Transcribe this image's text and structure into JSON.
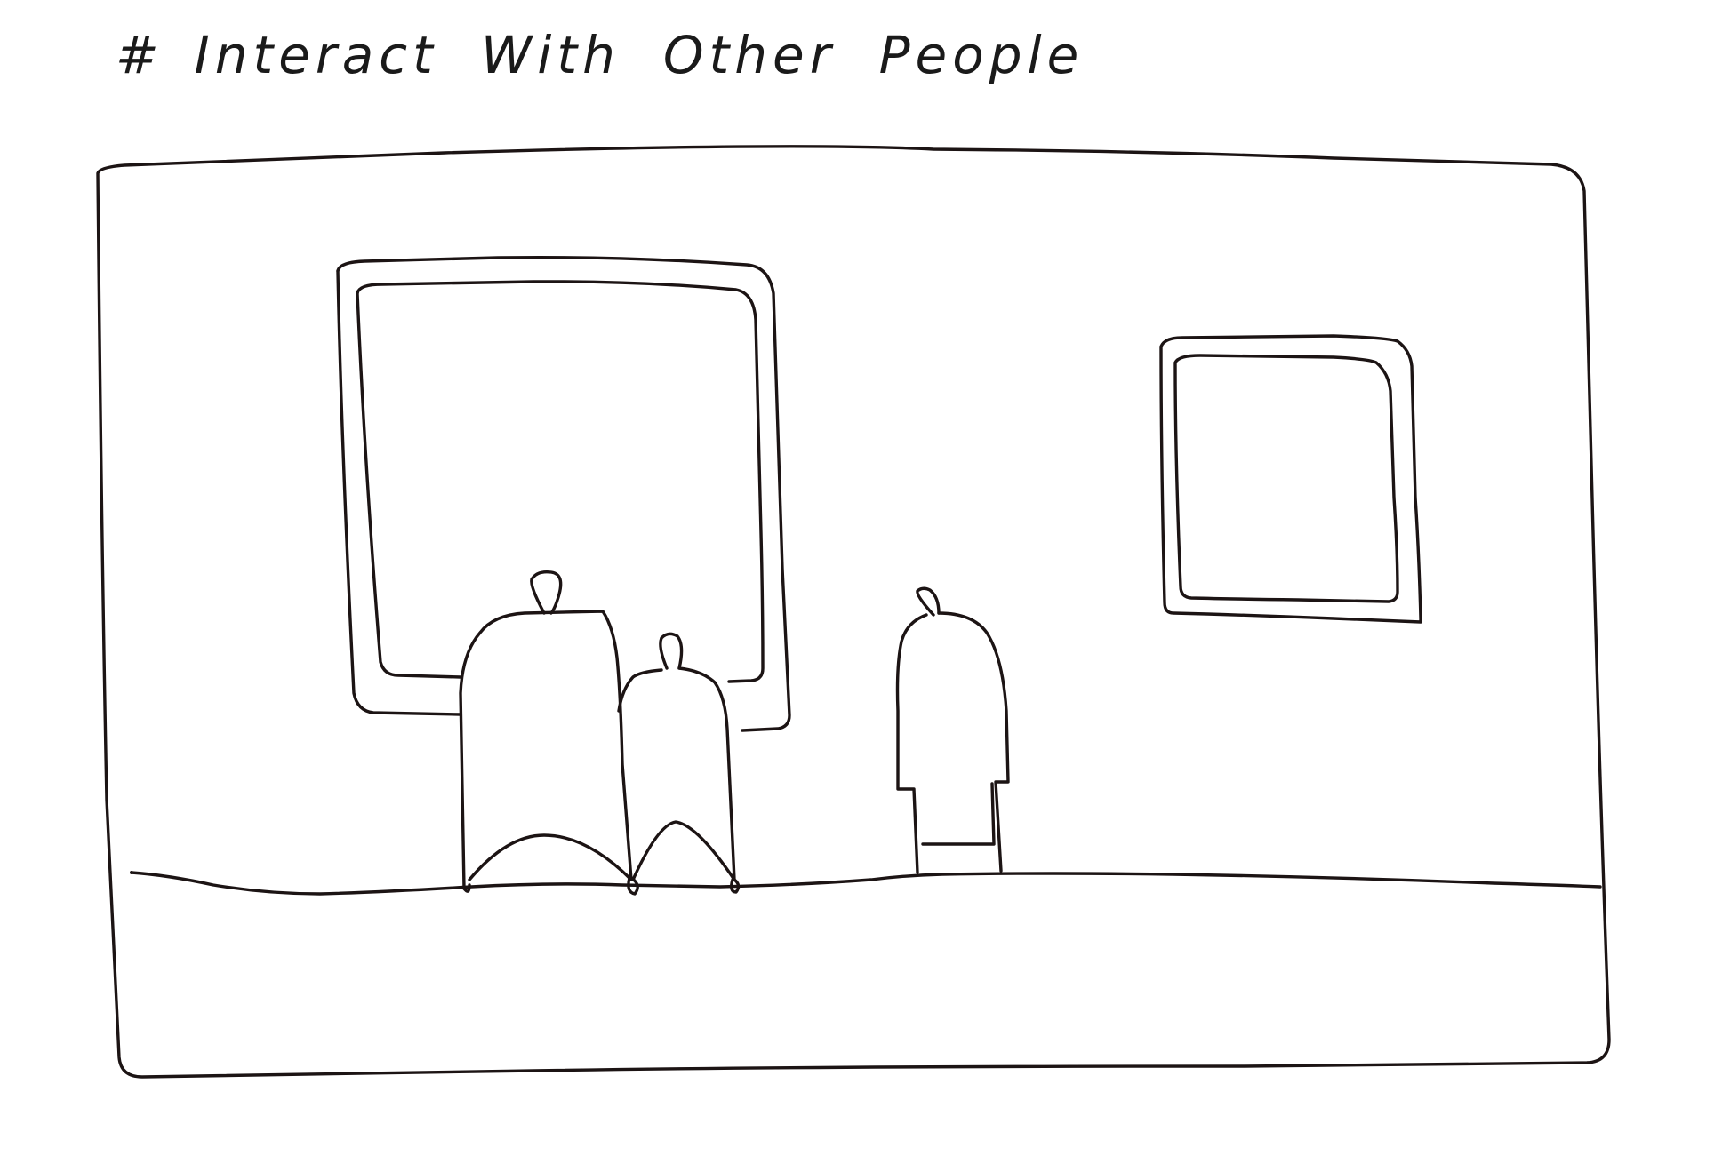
{
  "sketch": {
    "title": {
      "hash": "#",
      "words": [
        "Interact",
        "With",
        "Other",
        "People"
      ]
    },
    "ink_color": "#1c1414",
    "paper_color": "#ffffff"
  }
}
